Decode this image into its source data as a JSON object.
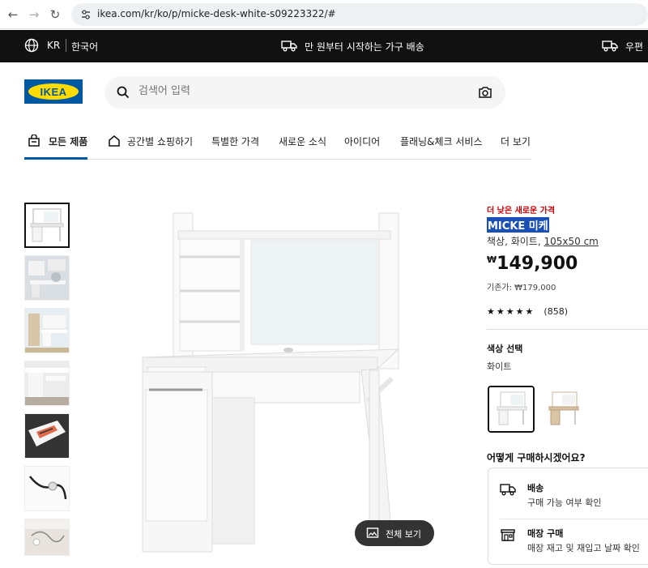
{
  "browser": {
    "url": "ikea.com/kr/ko/p/micke-desk-white-s09223322/#"
  },
  "topbar": {
    "region": "KR",
    "language": "한국어",
    "shipping_text": "만 원부터 시작하는 가구 배송",
    "right_text": "우편"
  },
  "header": {
    "logo_text": "IKEA",
    "search_placeholder": "검색어 입력"
  },
  "nav": {
    "tabs": [
      {
        "label": "모든 제품"
      },
      {
        "label": "공간별 쇼핑하기"
      },
      {
        "label": "특별한 가격"
      },
      {
        "label": "새로운 소식"
      },
      {
        "label": "아이디어"
      },
      {
        "label": "플래닝&체크 서비스"
      },
      {
        "label": "더 보기"
      }
    ]
  },
  "gallery": {
    "full_view_label": "전체 보기"
  },
  "product": {
    "badge": "더 낮은 새로운 가격",
    "name": "MICKE 미케",
    "desc": "책상, 화이트,",
    "dims": "105x50 cm",
    "currency": "₩",
    "price": "149,900",
    "original_price": "기존가: ₩179,000",
    "stars": "★★★★★",
    "rating_count": "(858)",
    "color_title": "색상 선택",
    "color_value": "화이트",
    "buy_title": "어떻게 구매하시겠어요?",
    "delivery_label": "배송",
    "delivery_sub": "구매 가능 여부 확인",
    "store_label": "매장 구매",
    "store_sub": "매장 재고 및 재입고 날짜 확인"
  },
  "colors": {
    "ikea_blue": "#0058a3",
    "ikea_yellow": "#ffdb00",
    "price_red": "#cc0008"
  }
}
